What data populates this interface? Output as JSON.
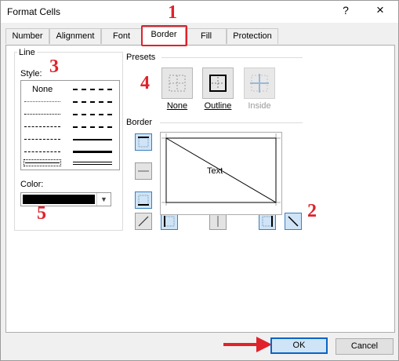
{
  "window": {
    "title": "Format Cells",
    "help": "?",
    "close": "×"
  },
  "tabs": [
    "Number",
    "Alignment",
    "Font",
    "Border",
    "Fill",
    "Protection"
  ],
  "active_tab": "Border",
  "line": {
    "group_label": "Line",
    "style_label": "Style:",
    "none_label": "None",
    "color_label": "Color:",
    "selected_color": "#000000"
  },
  "presets": {
    "label": "Presets",
    "items": [
      "None",
      "Outline",
      "Inside"
    ]
  },
  "border": {
    "label": "Border",
    "preview_text": "Text"
  },
  "annotations": {
    "tab": "1",
    "diagonal": "2",
    "style": "3",
    "presets": "4",
    "color": "5"
  },
  "buttons": {
    "ok": "OK",
    "cancel": "Cancel"
  },
  "colors": {
    "annotation_red": "#e0222b",
    "selected_blue": "#0a64c6"
  }
}
